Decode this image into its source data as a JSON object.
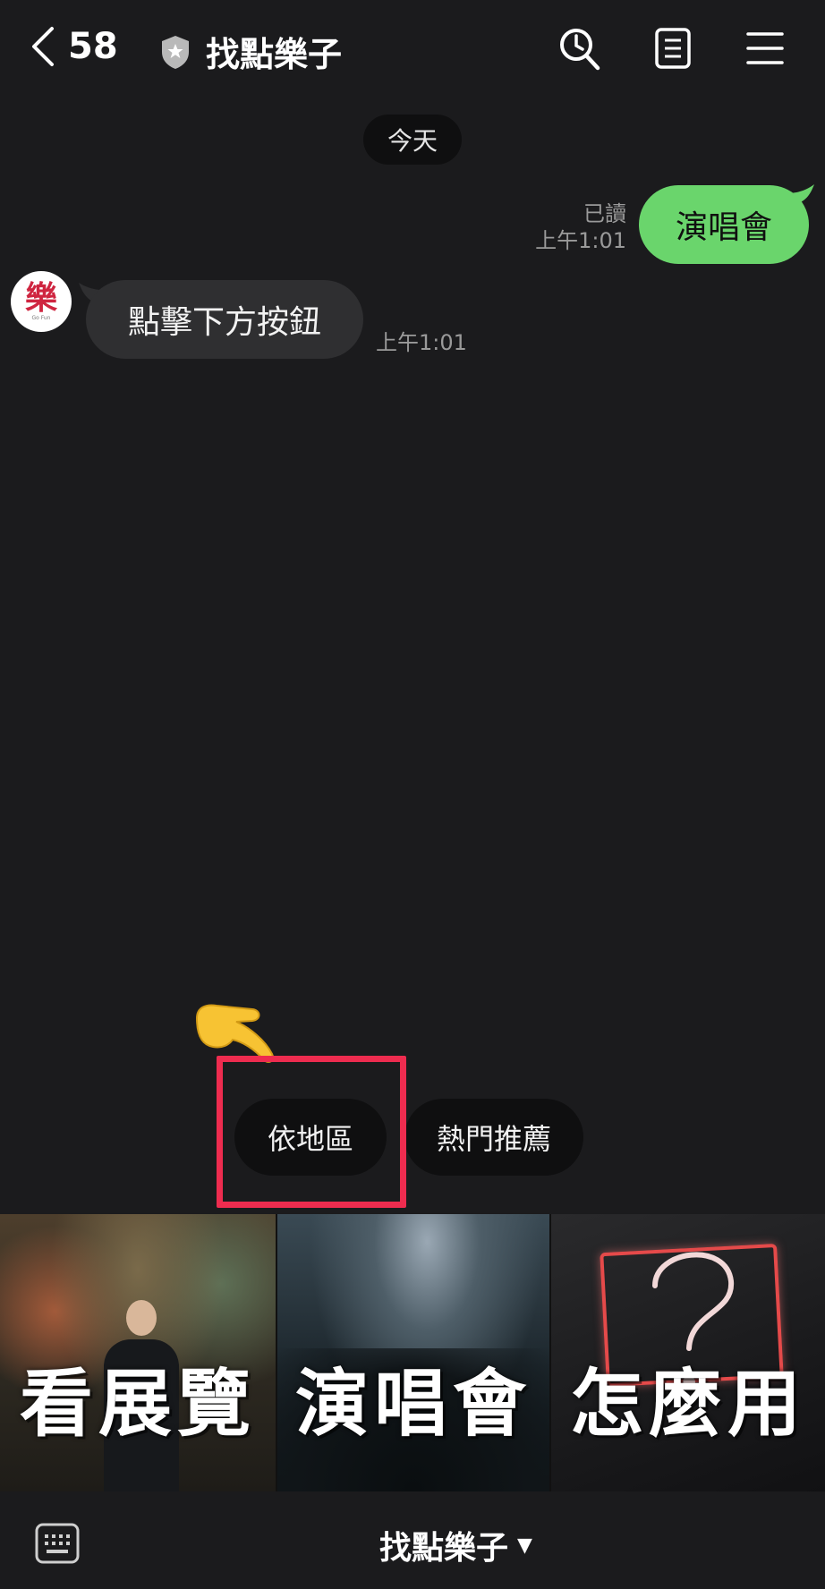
{
  "header": {
    "unread_count": "58",
    "chat_title": "找點樂子",
    "icons": [
      "back-chevron-icon",
      "shield-star-icon",
      "search-clock-icon",
      "notes-icon",
      "menu-icon"
    ]
  },
  "chat": {
    "date_divider": "今天",
    "outgoing": {
      "text": "演唱會",
      "read_label": "已讀",
      "time": "上午1:01",
      "bubble_color": "#6ad56c"
    },
    "incoming": {
      "text": "點擊下方按鈕",
      "time": "上午1:01",
      "avatar_glyph": "樂",
      "avatar_subtext": "Go Fun"
    }
  },
  "quick_replies": [
    {
      "label": "依地區"
    },
    {
      "label": "熱門推薦"
    }
  ],
  "highlight": {
    "color": "#ee2c4f"
  },
  "pointer_emoji": "👉",
  "rich_menu": {
    "tiles": [
      {
        "label": "看展覽"
      },
      {
        "label": "演唱會"
      },
      {
        "label": "怎麼用"
      }
    ]
  },
  "bottom_bar": {
    "title": "找點樂子",
    "caret": "▼"
  },
  "colors": {
    "background": "#1b1b1d",
    "incoming_bubble": "#2f2f31",
    "quick_reply_bg": "#0f0f10"
  }
}
